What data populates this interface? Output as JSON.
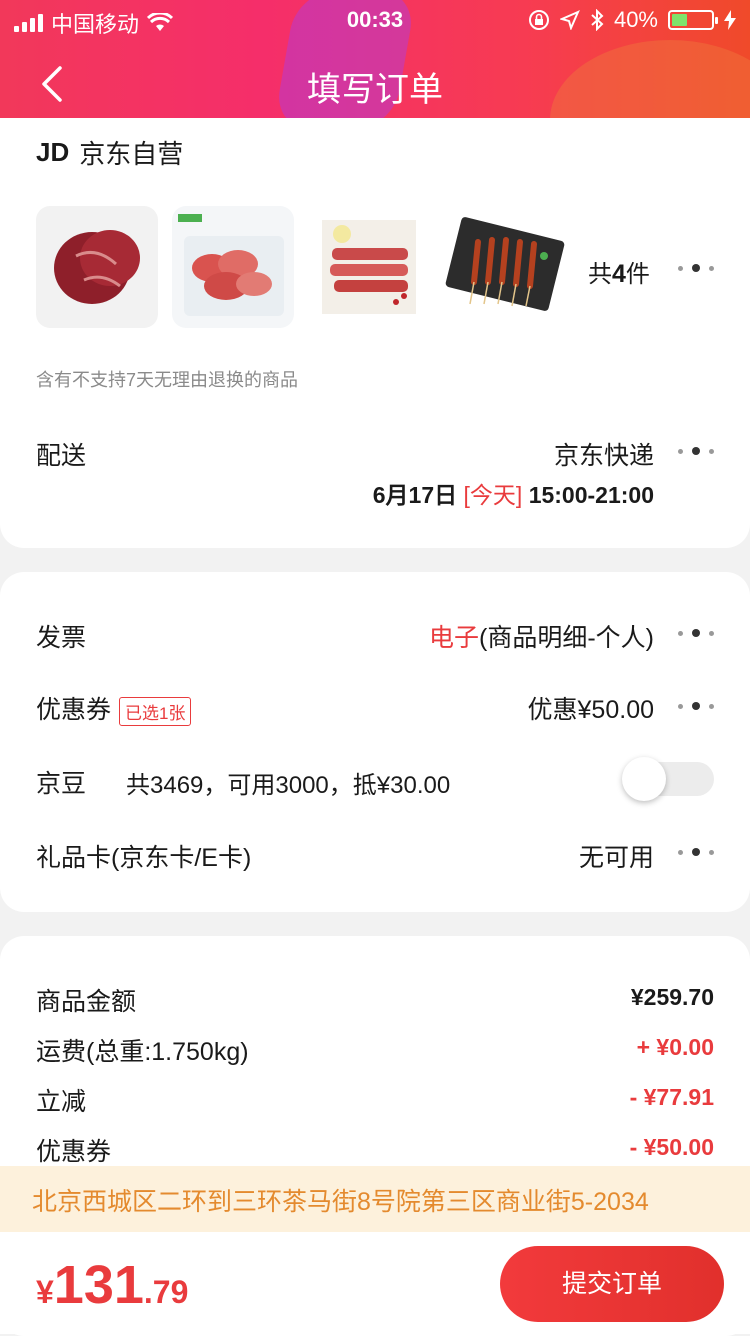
{
  "status_bar": {
    "carrier": "中国移动",
    "time": "00:33",
    "battery": "40%"
  },
  "header": {
    "title": "填写订单"
  },
  "order": {
    "shop_logo": "JD",
    "shop_name": "京东自营",
    "count_prefix": "共",
    "count_number": "4",
    "count_suffix": "件",
    "notice": "含有不支持7天无理由退换的商品",
    "delivery_label": "配送",
    "delivery_carrier": "京东快递",
    "delivery_date": "6月17日",
    "delivery_today": "[今天]",
    "delivery_window": "15:00-21:00"
  },
  "options": {
    "invoice_label": "发票",
    "invoice_type": "电子",
    "invoice_detail": "(商品明细-个人)",
    "coupon_label": "优惠券",
    "coupon_tag": "已选1张",
    "coupon_value": "优惠¥50.00",
    "jingdou_label": "京豆",
    "jingdou_desc": "共3469，可用3000，抵¥30.00",
    "giftcard_label": "礼品卡(京东卡/E卡)",
    "giftcard_value": "无可用"
  },
  "summary": {
    "goods_label": "商品金额",
    "goods_value": "¥259.70",
    "shipping_label": "运费(总重:1.750kg)",
    "shipping_value": "+ ¥0.00",
    "discount_label": "立减",
    "discount_value": "- ¥77.91",
    "coupon_label": "优惠券",
    "coupon_value": "- ¥50.00"
  },
  "address": "北京西城区二环到三环茶马街8号院第三区商业街5-2034",
  "footer": {
    "currency": "¥",
    "price_int": "131",
    "price_dec": ".79",
    "submit": "提交订单"
  },
  "colors": {
    "accent": "#e93b3d",
    "address_bg": "#fdf1dc",
    "address_text": "#e48a2e"
  }
}
